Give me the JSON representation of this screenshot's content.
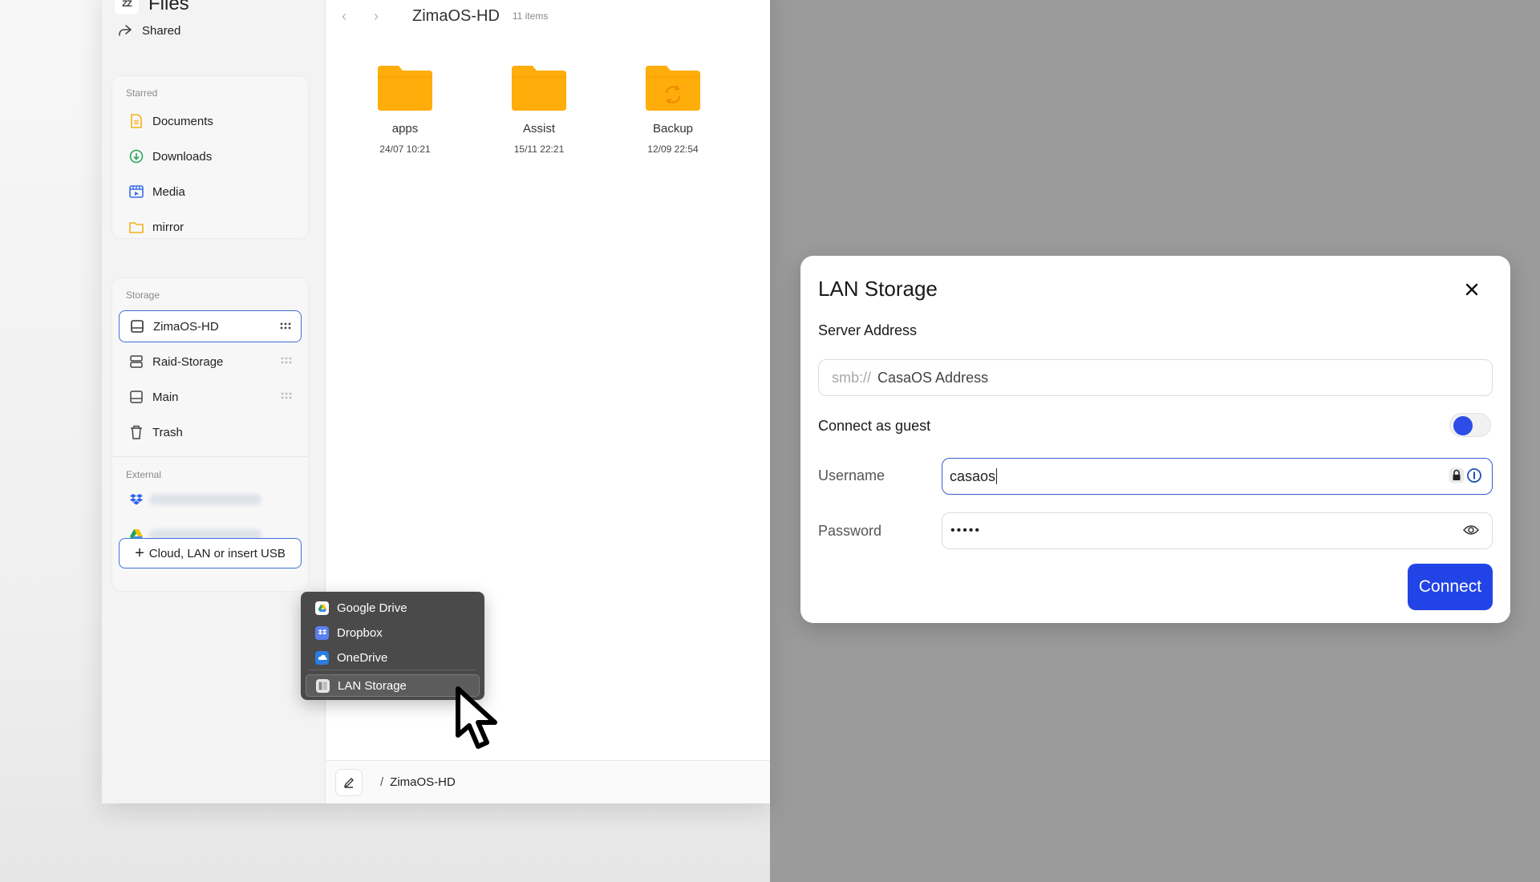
{
  "app": {
    "logo": "ZZ",
    "title": "Files"
  },
  "sidebar": {
    "shared_label": "Shared",
    "starred_label": "Starred",
    "starred_items": [
      {
        "label": "Documents",
        "icon": "document-icon"
      },
      {
        "label": "Downloads",
        "icon": "download-icon"
      },
      {
        "label": "Media",
        "icon": "media-icon"
      },
      {
        "label": "mirror",
        "icon": "folder-icon"
      }
    ],
    "storage_label": "Storage",
    "storage_items": [
      {
        "label": "ZimaOS-HD",
        "icon": "drive-icon",
        "active": true
      },
      {
        "label": "Raid-Storage",
        "icon": "raid-icon"
      },
      {
        "label": "Main",
        "icon": "drive-icon"
      },
      {
        "label": "Trash",
        "icon": "trash-icon"
      }
    ],
    "external_label": "External",
    "external_items": [
      {
        "icon": "dropbox-icon"
      },
      {
        "icon": "google-drive-icon"
      }
    ],
    "add_button_label": "Cloud, LAN or insert USB"
  },
  "main": {
    "title": "ZimaOS-HD",
    "count": "11 items",
    "files": [
      {
        "name": "apps",
        "date": "24/07 10:21"
      },
      {
        "name": "Assist",
        "date": "15/11 22:21"
      },
      {
        "name": "Backup",
        "date": "12/09 22:54",
        "sync": true
      }
    ],
    "path_separator": "/",
    "path": "ZimaOS-HD"
  },
  "context_menu": {
    "items": [
      "Google Drive",
      "Dropbox",
      "OneDrive",
      "LAN Storage"
    ],
    "hovered": "LAN Storage"
  },
  "dialog": {
    "title": "LAN Storage",
    "server_label": "Server Address",
    "server_prefix": "smb://",
    "server_placeholder": "CasaOS Address",
    "guest_label": "Connect as guest",
    "guest_enabled": false,
    "username_label": "Username",
    "username_value": "casaos",
    "password_label": "Password",
    "password_value": "•••••",
    "connect_label": "Connect"
  },
  "colors": {
    "accent": "#2244e6",
    "folder": "#ffad0a",
    "active_border": "#3f6fd9"
  }
}
